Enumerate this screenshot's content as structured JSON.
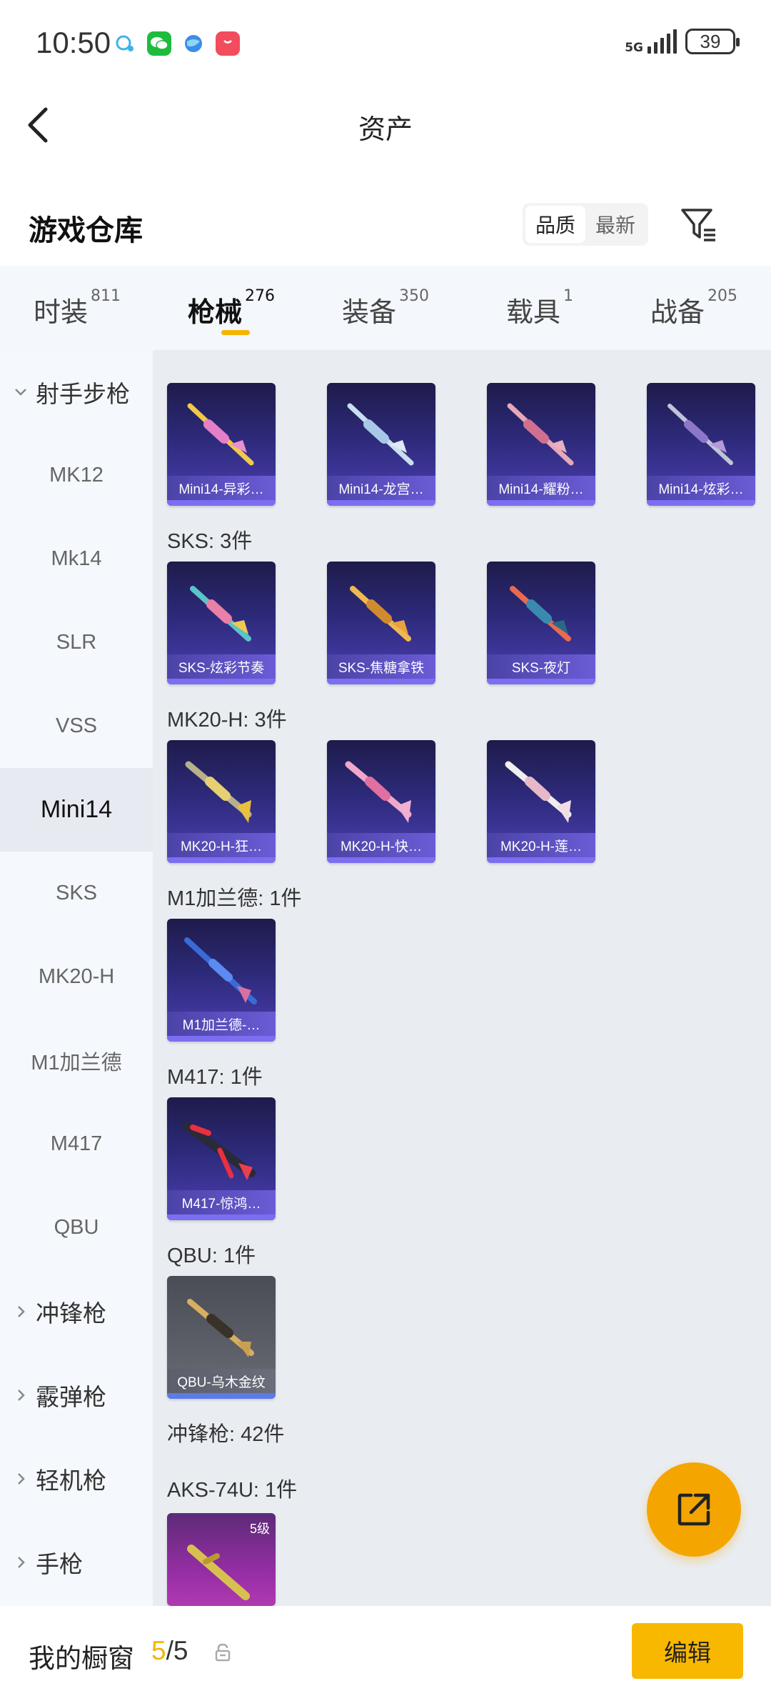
{
  "status_bar": {
    "time": "10:50",
    "network": "5G",
    "battery": "39",
    "notification_icons": [
      "message-bubble-icon",
      "wechat-icon",
      "browser-icon",
      "shop-bag-icon"
    ]
  },
  "header": {
    "title": "资产"
  },
  "warehouse": {
    "title": "游戏仓库",
    "sort_options": [
      "品质",
      "最新"
    ],
    "active_sort": "品质"
  },
  "tabs": [
    {
      "label": "时装",
      "count": "811"
    },
    {
      "label": "枪械",
      "count": "276",
      "active": true
    },
    {
      "label": "装备",
      "count": "350"
    },
    {
      "label": "载具",
      "count": "1"
    },
    {
      "label": "战备",
      "count": "205"
    }
  ],
  "sidebar": {
    "category_expanded": "射手步枪",
    "items": [
      "MK12",
      "Mk14",
      "SLR",
      "VSS",
      "Mini14",
      "SKS",
      "MK20-H",
      "M1加兰德",
      "M417",
      "QBU"
    ],
    "active_item": "Mini14",
    "collapsed_categories": [
      "冲锋枪",
      "霰弹枪",
      "轻机枪",
      "手枪"
    ]
  },
  "content": {
    "mini14_cards": [
      "Mini14-异彩…",
      "Mini14-龙宫…",
      "Mini14-耀粉…",
      "Mini14-炫彩…"
    ],
    "sks": {
      "label": "SKS: 3件",
      "cards": [
        "SKS-炫彩节奏",
        "SKS-焦糖拿铁",
        "SKS-夜灯"
      ]
    },
    "mk20h": {
      "label": "MK20-H: 3件",
      "cards": [
        "MK20-H-狂…",
        "MK20-H-快…",
        "MK20-H-莲…"
      ]
    },
    "m1": {
      "label": "M1加兰德: 1件",
      "cards": [
        "M1加兰德-…"
      ]
    },
    "m417": {
      "label": "M417: 1件",
      "cards": [
        "M417-惊鸿…"
      ]
    },
    "qbu": {
      "label": "QBU: 1件",
      "cards": [
        "QBU-乌木金纹"
      ]
    },
    "smg_label": "冲锋枪: 42件",
    "aks": {
      "label": "AKS-74U: 1件",
      "level": "5级"
    }
  },
  "bottom_bar": {
    "label": "我的橱窗",
    "count": "5",
    "total": "/5",
    "edit_label": "编辑"
  },
  "colors": {
    "accent": "#f4b400",
    "card_purple": "#2d2a7a",
    "sidebar_bg": "#f5f8fc",
    "content_bg": "#e9edf2"
  }
}
